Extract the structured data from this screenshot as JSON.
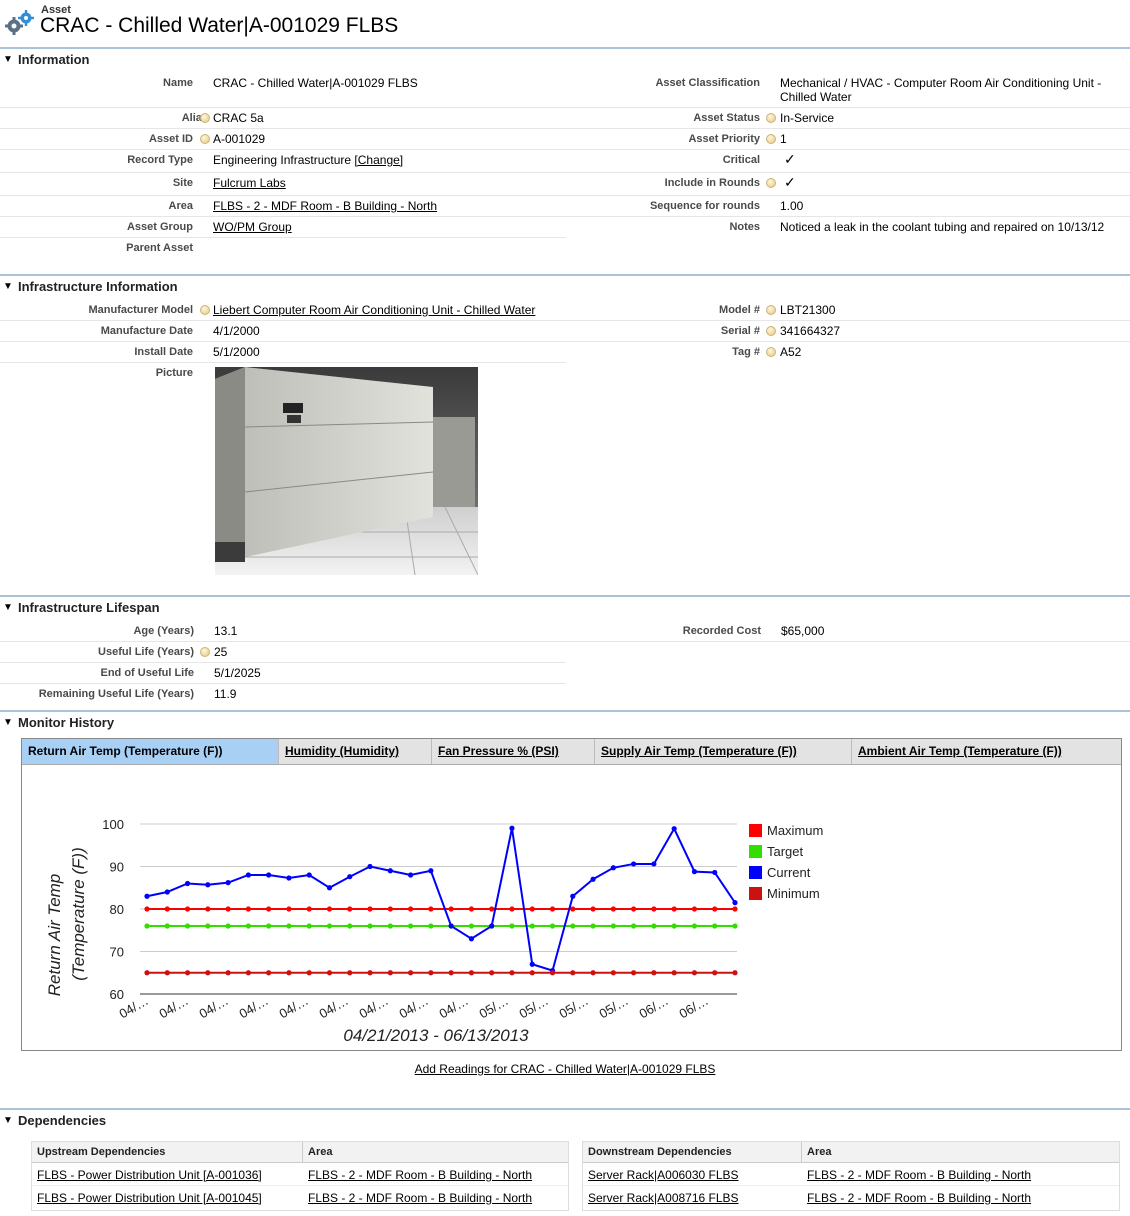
{
  "header": {
    "object_type": "Asset",
    "title": "CRAC - Chilled Water|A-001029 FLBS"
  },
  "information": {
    "section_title": "Information",
    "left": [
      {
        "label": "Name",
        "value": "CRAC - Chilled Water|A-001029 FLBS",
        "help": false
      },
      {
        "label": "Alias",
        "value": "CRAC 5a",
        "help": true
      },
      {
        "label": "Asset ID",
        "value": "A-001029",
        "help": true
      },
      {
        "label": "Record Type",
        "value": "Engineering Infrastructure",
        "change_link": "[Change]",
        "help": false
      },
      {
        "label": "Site",
        "value": "Fulcrum Labs",
        "link": true,
        "help": false
      },
      {
        "label": "Area",
        "value": "FLBS - 2 - MDF Room - B Building - North",
        "link": true,
        "help": false
      },
      {
        "label": "Asset Group",
        "value": "WO/PM Group",
        "link": true,
        "help": false
      },
      {
        "label": "Parent Asset",
        "value": "",
        "help": false
      }
    ],
    "right": [
      {
        "label": "Asset Classification",
        "value_line1": "Mechanical / HVAC - Computer Room Air Conditioning Unit -",
        "value_line2": "Chilled Water",
        "help": false
      },
      {
        "label": "Asset Status",
        "value": "In-Service",
        "help": true
      },
      {
        "label": "Asset Priority",
        "value": "1",
        "help": true
      },
      {
        "label": "Critical",
        "value": "✓",
        "help": false
      },
      {
        "label": "Include in Rounds",
        "value": "✓",
        "help": true
      },
      {
        "label": "Sequence for rounds",
        "value": "1.00",
        "help": false
      },
      {
        "label": "Notes",
        "value": "Noticed a leak in the coolant tubing and repaired on 10/13/12",
        "help": false
      }
    ]
  },
  "infrastructure": {
    "section_title": "Infrastructure Information",
    "left": [
      {
        "label": "Manufacturer Model",
        "value": "Liebert Computer Room Air Conditioning Unit - Chilled Water",
        "link": true,
        "help": true
      },
      {
        "label": "Manufacture Date",
        "value": "4/1/2000",
        "help": false
      },
      {
        "label": "Install Date",
        "value": "5/1/2000",
        "help": false
      },
      {
        "label": "Picture",
        "value": "",
        "help": false
      }
    ],
    "right": [
      {
        "label": "Model #",
        "value": "LBT21300",
        "help": true
      },
      {
        "label": "Serial #",
        "value": "341664327",
        "help": true
      },
      {
        "label": "Tag #",
        "value": "A52",
        "help": true
      }
    ]
  },
  "lifespan": {
    "section_title": "Infrastructure Lifespan",
    "left": [
      {
        "label": "Age (Years)",
        "value": "13.1",
        "help": false
      },
      {
        "label": "Useful Life (Years)",
        "value": "25",
        "help": true
      },
      {
        "label": "End of Useful Life",
        "value": "5/1/2025",
        "help": false
      },
      {
        "label": "Remaining Useful Life (Years)",
        "value": "11.9",
        "help": false
      }
    ],
    "right": [
      {
        "label": "Recorded Cost",
        "value": "$65,000",
        "help": false
      }
    ]
  },
  "monitor": {
    "section_title": "Monitor History",
    "tabs": [
      {
        "label": "Return Air Temp (Temperature (F))",
        "active": true
      },
      {
        "label": "Humidity (Humidity)",
        "active": false
      },
      {
        "label": "Fan Pressure % (PSI)",
        "active": false
      },
      {
        "label": "Supply Air Temp (Temperature (F))",
        "active": false
      },
      {
        "label": "Ambient Air Temp (Temperature (F))",
        "active": false
      }
    ],
    "add_readings_link": "Add Readings for CRAC - Chilled Water|A-001029 FLBS"
  },
  "chart_data": {
    "type": "line",
    "xlabel": "04/21/2013 - 06/13/2013",
    "ylabel_line1": "Return Air Temp",
    "ylabel_line2": "(Temperature (F))",
    "ylim": [
      60,
      100
    ],
    "yticks": [
      60,
      70,
      80,
      90,
      100
    ],
    "xtick_labels": [
      "04/…",
      "04/…",
      "04/…",
      "04/…",
      "04/…",
      "04/…",
      "04/…",
      "04/…",
      "04/…",
      "05/…",
      "05/…",
      "05/…",
      "05/…",
      "06/…",
      "06/…"
    ],
    "grid": true,
    "legend_position": "right",
    "series": [
      {
        "name": "Maximum",
        "color": "#ff0000",
        "values": [
          80,
          80,
          80,
          80,
          80,
          80,
          80,
          80,
          80,
          80,
          80,
          80,
          80,
          80,
          80,
          80,
          80,
          80,
          80,
          80,
          80,
          80,
          80,
          80,
          80,
          80,
          80,
          80,
          80,
          80
        ]
      },
      {
        "name": "Target",
        "color": "#33dd00",
        "values": [
          76,
          76,
          76,
          76,
          76,
          76,
          76,
          76,
          76,
          76,
          76,
          76,
          76,
          76,
          76,
          76,
          76,
          76,
          76,
          76,
          76,
          76,
          76,
          76,
          76,
          76,
          76,
          76,
          76,
          76
        ]
      },
      {
        "name": "Current",
        "color": "#0000ff",
        "values": [
          83,
          84,
          86,
          85.7,
          86.2,
          88,
          88,
          87.3,
          88,
          85,
          87.6,
          90,
          89,
          88,
          89,
          76,
          73,
          76,
          99,
          67,
          65.5,
          83,
          87,
          89.7,
          90.6,
          90.6,
          98.9,
          88.8,
          88.6,
          81.5
        ]
      },
      {
        "name": "Minimum",
        "color": "#cc1111",
        "values": [
          65,
          65,
          65,
          65,
          65,
          65,
          65,
          65,
          65,
          65,
          65,
          65,
          65,
          65,
          65,
          65,
          65,
          65,
          65,
          65,
          65,
          65,
          65,
          65,
          65,
          65,
          65,
          65,
          65,
          65
        ]
      }
    ]
  },
  "dependencies": {
    "section_title": "Dependencies",
    "upstream": {
      "header": "Upstream Dependencies",
      "area_header": "Area",
      "rows": [
        {
          "name": "FLBS - Power Distribution Unit [A-001036]",
          "area": "FLBS - 2 - MDF Room - B Building - North"
        },
        {
          "name": "FLBS - Power Distribution Unit [A-001045]",
          "area": "FLBS - 2 - MDF Room - B Building - North"
        }
      ]
    },
    "downstream": {
      "header": "Downstream Dependencies",
      "area_header": "Area",
      "rows": [
        {
          "name": "Server Rack|A006030 FLBS",
          "area": "FLBS - 2 - MDF Room - B Building - North"
        },
        {
          "name": "Server Rack|A008716 FLBS",
          "area": "FLBS - 2 - MDF Room - B Building - North"
        }
      ]
    }
  }
}
